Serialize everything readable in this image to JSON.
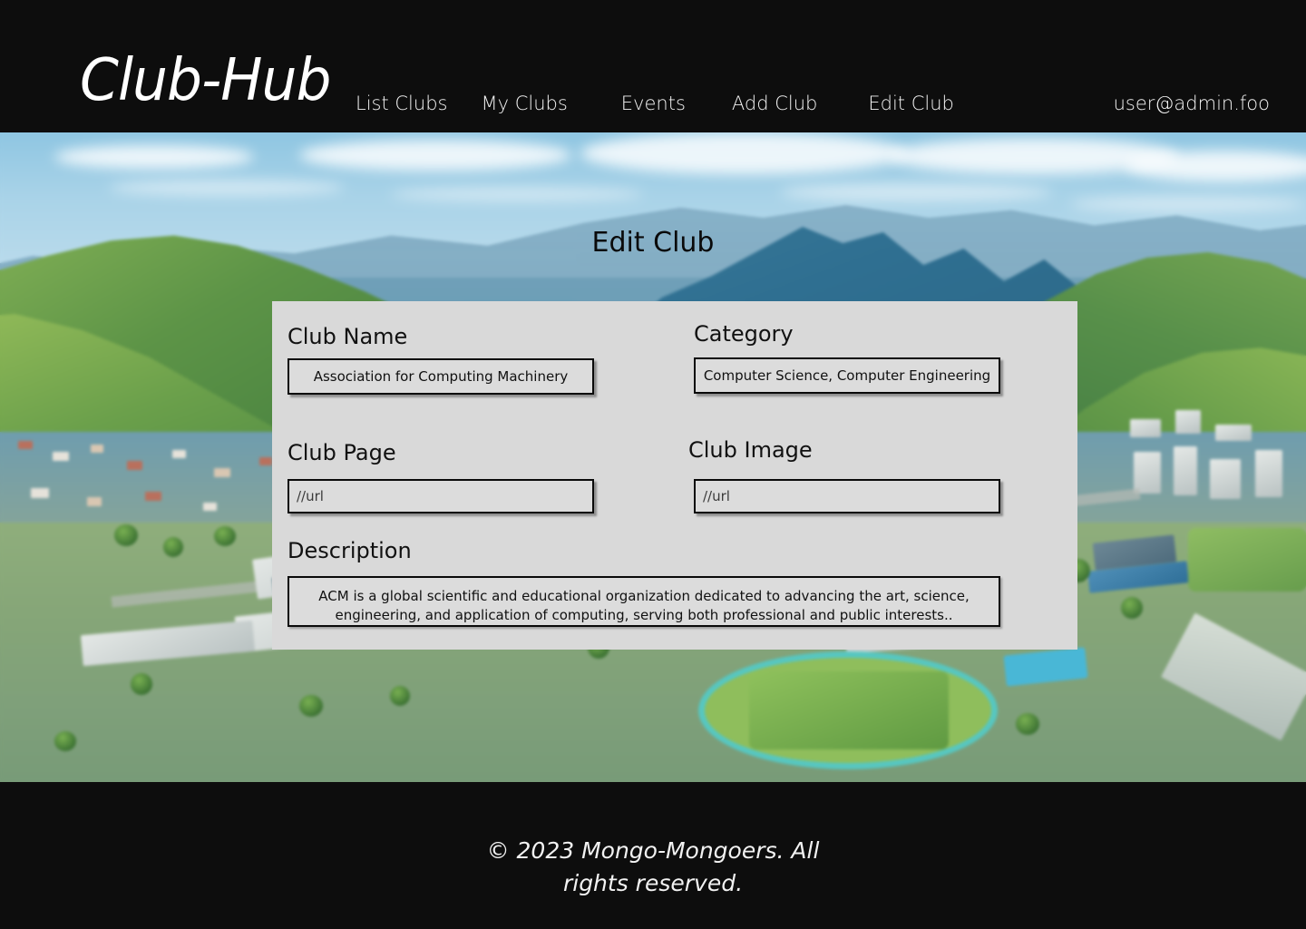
{
  "header": {
    "brand": "Club-Hub",
    "nav": [
      {
        "label": "List Clubs",
        "name": "nav-list-clubs"
      },
      {
        "label": "My Clubs",
        "name": "nav-my-clubs"
      },
      {
        "label": "Events",
        "name": "nav-events"
      },
      {
        "label": "Add Club",
        "name": "nav-add-club"
      },
      {
        "label": "Edit Club",
        "name": "nav-edit-club"
      }
    ],
    "account": "user@admin.foo",
    "background_color": "#0d0d0d",
    "text_color": "#f2f2f2"
  },
  "page": {
    "title": "Edit Club",
    "panel_color": "#d9d9d9",
    "hero_alt": "aerial-photo-green-mountains-campus"
  },
  "form": {
    "fields": {
      "club_name": {
        "label": "Club Name",
        "value": "Association for Computing Machinery",
        "placeholder": "Club Name"
      },
      "category": {
        "label": "Category",
        "value": "Computer Science, Computer Engineering",
        "placeholder": "Category"
      },
      "club_page": {
        "label": "Club Page",
        "value": "",
        "placeholder": "//url"
      },
      "club_image": {
        "label": "Club Image",
        "value": "",
        "placeholder": "//url"
      },
      "description": {
        "label": "Description",
        "value": "ACM is a global scientific and educational organization dedicated to advancing the art, science, engineering, and application of computing, serving both professional and public interests..",
        "placeholder": "Description"
      }
    }
  },
  "footer": {
    "copyright": "© 2023 Mongo-Mongoers. All rights reserved."
  }
}
